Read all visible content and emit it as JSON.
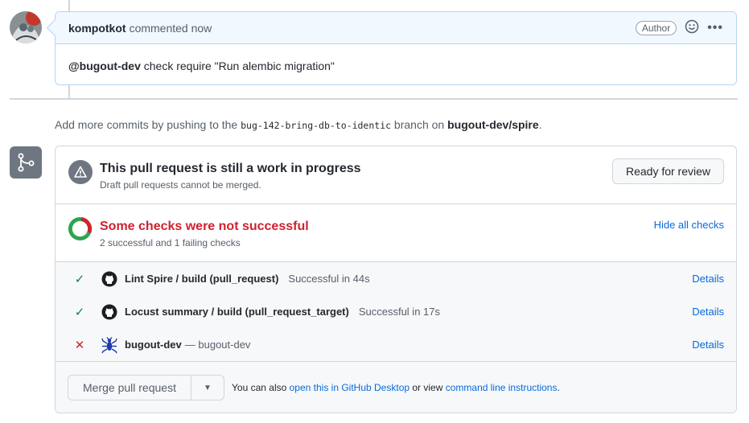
{
  "comment": {
    "author": "kompotkot",
    "action": "commented now",
    "badge": "Author",
    "mention": "@bugout-dev",
    "body": " check require \"Run alembic migration\""
  },
  "push_note": {
    "prefix": "Add more commits by pushing to the ",
    "branch": "bug-142-bring-db-to-identic",
    "middle": " branch on ",
    "repo": "bugout-dev/spire",
    "suffix": "."
  },
  "draft": {
    "title": "This pull request is still a work in progress",
    "subtitle": "Draft pull requests cannot be merged.",
    "ready_button": "Ready for review"
  },
  "checks": {
    "title": "Some checks were not successful",
    "subtitle": "2 successful and 1 failing checks",
    "hide_link": "Hide all checks",
    "successful_count": 2,
    "failing_count": 1,
    "items": [
      {
        "status": "success",
        "status_icon": "✓",
        "app_icon": "github-icon",
        "name": "Lint Spire / build (pull_request)",
        "description": "Successful in 44s",
        "details": "Details"
      },
      {
        "status": "success",
        "status_icon": "✓",
        "app_icon": "github-icon",
        "name": "Locust summary / build (pull_request_target)",
        "description": "Successful in 17s",
        "details": "Details"
      },
      {
        "status": "failure",
        "status_icon": "✕",
        "app_icon": "bug-icon",
        "name": "bugout-dev",
        "description": "— bugout-dev",
        "details": "Details"
      }
    ]
  },
  "merge": {
    "button": "Merge pull request",
    "caret": "▼",
    "note_prefix": "You can also ",
    "desktop_link": "open this in GitHub Desktop",
    "note_middle": " or view ",
    "cli_link": "command line instructions",
    "note_suffix": "."
  },
  "colors": {
    "success": "#1a7f37",
    "failure": "#cf222e",
    "link": "#0969da",
    "comment_border": "#b6d4f4"
  }
}
